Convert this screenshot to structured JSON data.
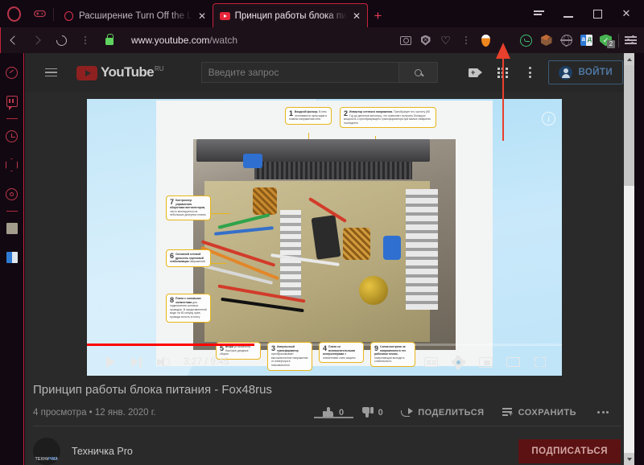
{
  "browser": {
    "name": "Opera",
    "tabs": [
      {
        "title": "Расширение Turn Off the L",
        "favicon": "opera-icon",
        "active": false
      },
      {
        "title": "Принцип работы блока пи",
        "favicon": "youtube-icon",
        "active": true
      }
    ],
    "new_tab_label": "+",
    "window_controls": {
      "menu": "list-icon",
      "minimize": "_",
      "maximize": "□",
      "close": "✕"
    },
    "address_bar": {
      "url_host": "www.youtube.com",
      "url_path": "/watch",
      "lock": "secure-lock-icon",
      "back": "back-icon",
      "forward": "forward-icon",
      "reload": "reload-icon"
    },
    "toolbar_extensions": [
      "camera-icon",
      "shield-icon",
      "heart-icon",
      "water-drop-icon",
      "lightbulb-icon",
      "check-circle-icon",
      "cube-icon",
      "globe-icon",
      "translate-icon",
      "antivirus-shield-icon"
    ],
    "antivirus_badge": "2",
    "easy_setup_icon": "sliders-icon",
    "sidebar": [
      "speed-dial-icon",
      "twitch-icon",
      "divider",
      "history-clock-icon",
      "package-cube-icon",
      "settings-gear-icon",
      "divider",
      "app-tile-icon",
      "app-translate-icon"
    ]
  },
  "youtube": {
    "menu_icon": "hamburger-menu-icon",
    "logo_text": "YouTube",
    "logo_region": "RU",
    "search": {
      "placeholder": "Введите запрос",
      "value": "",
      "button_icon": "search-icon"
    },
    "header_icons": [
      "create-video-icon",
      "apps-grid-icon",
      "more-kebab-icon"
    ],
    "sign_in_label": "ВОЙТИ",
    "sign_in_avatar": "account-circle-icon"
  },
  "player": {
    "current_time": "3:27",
    "duration": "9:45",
    "time_display": "3:27 / 9:45",
    "progress_percent": 35.2,
    "progress_color": "#ff0000",
    "controls": {
      "play": "play-icon",
      "next": "next-video-icon",
      "volume": "volume-icon",
      "subtitles": "closed-captions-icon",
      "settings": "settings-gear-icon",
      "miniplayer": "miniplayer-icon",
      "theater": "theater-mode-icon",
      "fullscreen": "fullscreen-icon"
    },
    "info_button": "info-icon",
    "slide_callouts": [
      {
        "num": "1",
        "head": "Входной фильтр.",
        "body": "В нем отсеиваются пульсации и помехи напряжения сети"
      },
      {
        "num": "2",
        "head": "Инвертор сетевого напряжения.",
        "body": "Преобразует его частоту (50 Гц) до десятков килогерц, что позволяет получить большую мощность с преобразующего трансформатора при малых габаритах последнего"
      },
      {
        "num": "7",
        "head": "Контроллер управления оборотами вентиляторов,",
        "body": "часто монтируется на небольших дочерних платах"
      },
      {
        "num": "6",
        "head": "Основной сетевой дроссель групповой стабилизации",
        "body": "напряжений"
      },
      {
        "num": "8",
        "head": "Плата с силовыми элементами",
        "body": "для подключения силовых проводов. В представленной моде ли 80 секунд хуже, провода вплоть в плату"
      },
      {
        "num": "5",
        "head": "втори",
        "body": "установлены быстрые диодные сборки"
      },
      {
        "num": "3",
        "head": "Импульсный трансформатор",
        "body": "преобразовывает высоковольтное напряжение от инвертора в низковольтное"
      },
      {
        "num": "4",
        "head": "Плата со вспомогательными контроллерами",
        "body": "и элементами схем защиты"
      },
      {
        "num": "9",
        "head": "Схема контроля за напряжением в тех рабочими точках,",
        "body": "позволяющая выходить стабильность"
      }
    ]
  },
  "video": {
    "title": "Принцип работы блока питания - Fox48rus",
    "views": "4 просмотра",
    "date": "12 янв. 2020 г.",
    "meta_separator": "•",
    "likes": "0",
    "dislikes": "0",
    "share_label": "ПОДЕЛИТЬСЯ",
    "save_label": "СОХРАНИТЬ",
    "more_label": "more-options-icon",
    "channel_name": "Техничка Pro",
    "channel_avatar_text": "ТЕХНИЧКА",
    "subscribe_label": "ПОДПИСАТЬСЯ"
  },
  "annotation": {
    "arrow_color": "#e8402c",
    "points_to": "lightbulb-icon"
  },
  "scrollbar": {
    "up_arrow": "scroll-up-icon",
    "down_arrow": "scroll-down-icon"
  }
}
